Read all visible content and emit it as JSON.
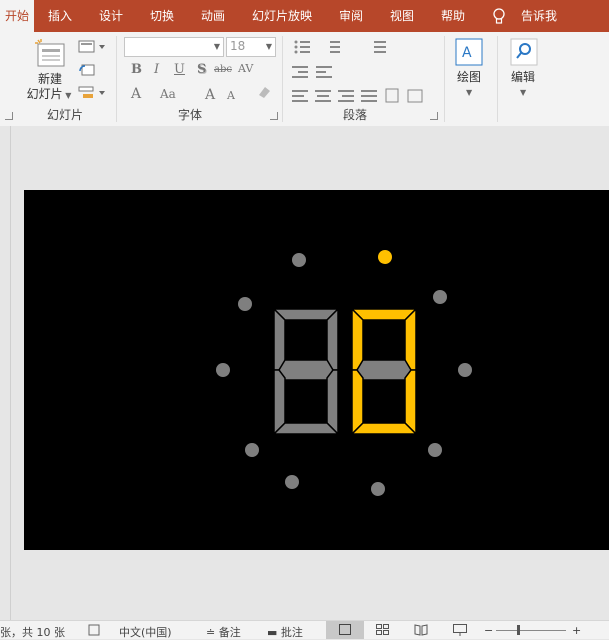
{
  "tabs": [
    {
      "label": "开始",
      "active": true
    },
    {
      "label": "插入"
    },
    {
      "label": "设计"
    },
    {
      "label": "切换"
    },
    {
      "label": "动画"
    },
    {
      "label": "幻灯片放映"
    },
    {
      "label": "审阅"
    },
    {
      "label": "视图"
    },
    {
      "label": "帮助"
    },
    {
      "label": "告诉我"
    }
  ],
  "ribbon": {
    "new_slide_label_1": "新建",
    "new_slide_label_2": "幻灯片",
    "group_slides": "幻灯片",
    "group_font": "字体",
    "group_paragraph": "段落",
    "font_size_value": "18",
    "bold": "B",
    "italic": "I",
    "underline": "U",
    "shadow": "S",
    "strike": "abc",
    "spacing": "AV",
    "font_color": "A",
    "change_case": "Aa",
    "draw_label": "绘图",
    "edit_label": "编辑"
  },
  "status": {
    "slide_info": "张，共 10 张",
    "language": "中文(中国)",
    "notes": "备注",
    "comments": "批注"
  },
  "colors": {
    "accent": "#b7472a",
    "segment_gray": "#808080",
    "segment_gold": "#ffc000",
    "dot_gray": "#7f7f7f",
    "dot_gold": "#ffc000"
  }
}
